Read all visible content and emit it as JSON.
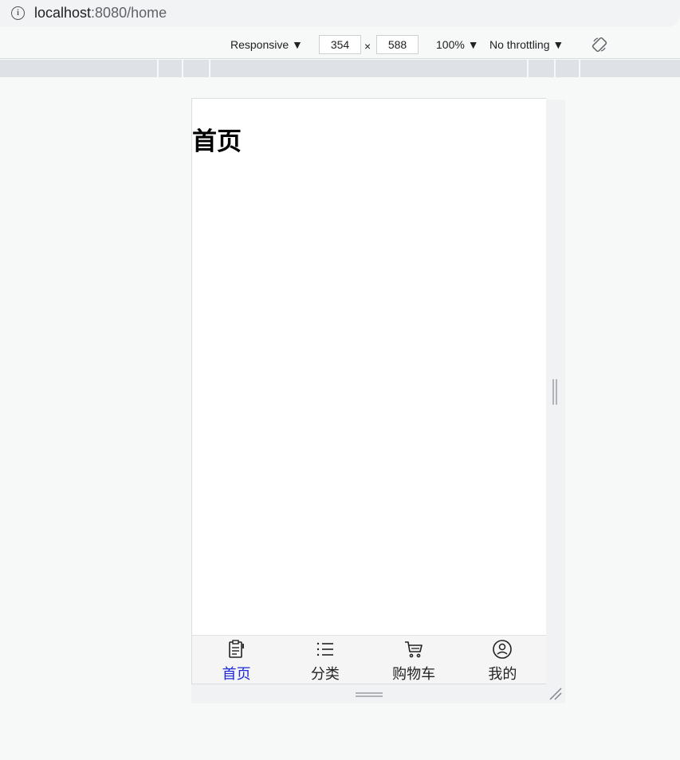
{
  "address_bar": {
    "host": "localhost",
    "path": ":8080/home",
    "info_icon": "info-icon"
  },
  "device_toolbar": {
    "device_mode": "Responsive ▼",
    "width": "354",
    "times": "×",
    "height": "588",
    "zoom": "100% ▼",
    "throttling": "No throttling ▼",
    "rotate_icon": "rotate-icon"
  },
  "page": {
    "heading": "首页"
  },
  "tabbar": {
    "active_color": "#1e2ad8",
    "tabs": [
      {
        "label": "首页",
        "icon": "clipboard-icon",
        "active": true
      },
      {
        "label": "分类",
        "icon": "list-icon",
        "active": false
      },
      {
        "label": "购物车",
        "icon": "cart-icon",
        "active": false
      },
      {
        "label": "我的",
        "icon": "user-circle-icon",
        "active": false
      }
    ]
  }
}
